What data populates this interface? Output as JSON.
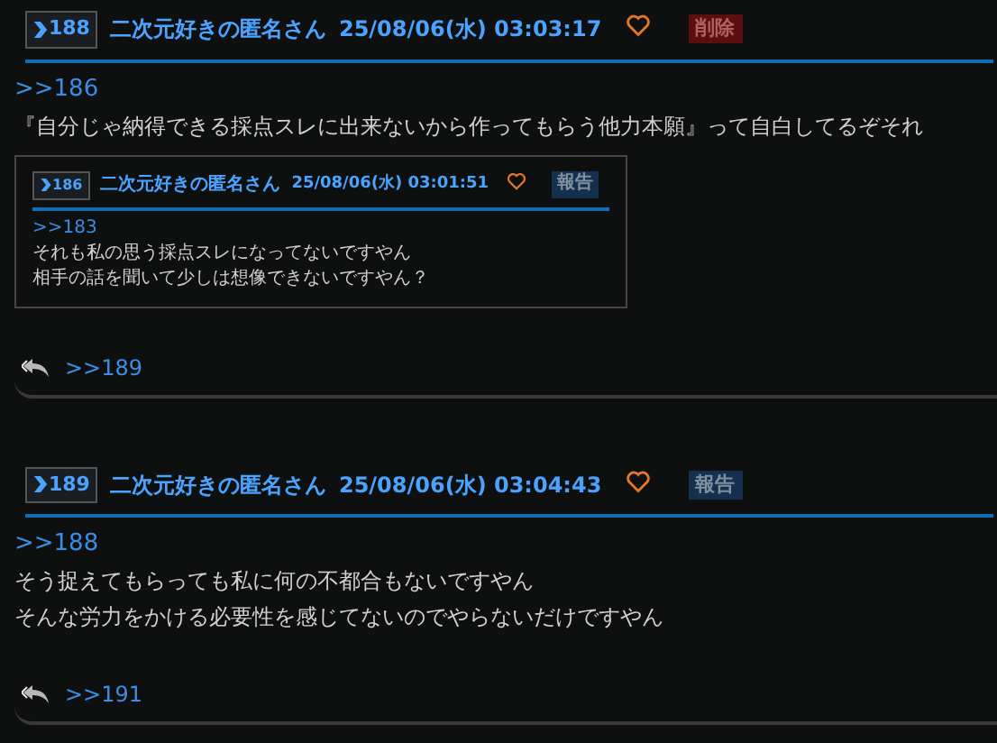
{
  "posts": [
    {
      "number": "188",
      "name": "二次元好きの匿名さん",
      "date": "25/08/06(水) 03:03:17",
      "action": {
        "kind": "delete",
        "label": "削除"
      },
      "anchor": ">>186",
      "lines": [
        "『自分じゃ納得できる採点スレに出来ないから作ってもらう他力本願』って自白してるぞそれ"
      ],
      "quote": {
        "number": "186",
        "name": "二次元好きの匿名さん",
        "date": "25/08/06(水) 03:01:51",
        "action": {
          "kind": "report",
          "label": "報告"
        },
        "anchor": ">>183",
        "lines": [
          "それも私の思う採点スレになってないですやん",
          "相手の話を聞いて少しは想像できないですやん？"
        ]
      },
      "replies": [
        ">>189"
      ]
    },
    {
      "number": "189",
      "name": "二次元好きの匿名さん",
      "date": "25/08/06(水) 03:04:43",
      "action": {
        "kind": "report",
        "label": "報告"
      },
      "anchor": ">>188",
      "lines": [
        "そう捉えてもらっても私に何の不都合もないですやん",
        "そんな労力をかける必要性を感じてないのでやらないだけですやん"
      ],
      "replies": [
        ">>191"
      ]
    }
  ]
}
